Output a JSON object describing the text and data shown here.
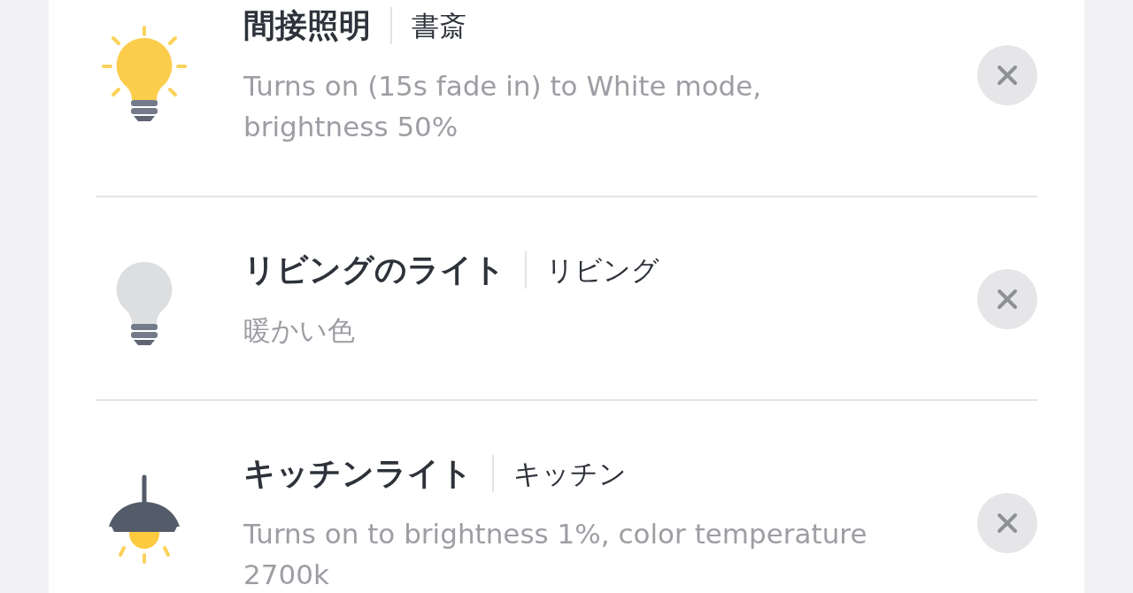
{
  "devices": [
    {
      "kind": "bulb",
      "on": true,
      "name": "間接照明",
      "room": "書斎",
      "description": "Turns on (15s fade in) to White mode, brightness 50%"
    },
    {
      "kind": "bulb",
      "on": false,
      "name": "リビングのライト",
      "room": "リビング",
      "description": "暖かい色"
    },
    {
      "kind": "pendant",
      "on": true,
      "name": "キッチンライト",
      "room": "キッチン",
      "description": "Turns on to brightness 1%, color temperature 2700k"
    }
  ]
}
